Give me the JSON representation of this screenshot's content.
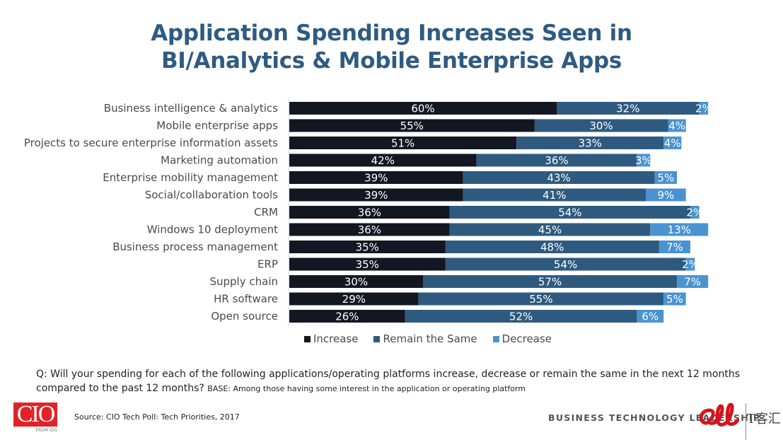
{
  "title_line1": "Application Spending Increases Seen in",
  "title_line2": "BI/Analytics & Mobile Enterprise Apps",
  "colors": {
    "increase": "#131722",
    "remain": "#2f5a7f",
    "decrease": "#4a93d1",
    "title": "#2e5b82",
    "cio_red": "#e32228"
  },
  "chart_data": {
    "type": "bar",
    "orientation": "horizontal",
    "stacked": true,
    "title": "Application Spending Increases Seen in BI/Analytics & Mobile Enterprise Apps",
    "xlabel": "",
    "ylabel": "",
    "xlim": [
      0,
      100
    ],
    "grid": false,
    "legend_position": "bottom",
    "categories": [
      "Business intelligence & analytics",
      "Mobile enterprise apps",
      "Projects to secure enterprise information assets",
      "Marketing automation",
      "Enterprise mobility management",
      "Social/collaboration tools",
      "CRM",
      "Windows 10 deployment",
      "Business process management",
      "ERP",
      "Supply chain",
      "HR software",
      "Open source"
    ],
    "series": [
      {
        "name": "Increase",
        "values": [
          60,
          55,
          51,
          42,
          39,
          39,
          36,
          36,
          35,
          35,
          30,
          29,
          26
        ]
      },
      {
        "name": "Remain the Same",
        "values": [
          32,
          30,
          33,
          36,
          43,
          41,
          54,
          45,
          48,
          54,
          57,
          55,
          52
        ]
      },
      {
        "name": "Decrease",
        "values": [
          2,
          4,
          4,
          3,
          5,
          9,
          2,
          13,
          7,
          2,
          7,
          5,
          6
        ]
      }
    ],
    "value_suffix": "%"
  },
  "legend": {
    "increase": "Increase",
    "remain": "Remain the Same",
    "decrease": "Decrease"
  },
  "footer": {
    "question": "Q: Will your spending for each of the following applications/operating platforms increase, decrease or remain the same in the next 12 months compared to the past 12 months?",
    "base": "BASE: Among those having some interest in the application or operating platform",
    "source": "Source: CIO Tech Poll: Tech Priorities, 2017",
    "cio_logo": "CIO",
    "from_idg": "FROM IDG",
    "tagline": "BUSINESS TECHNOLOGY LEADERSHIP",
    "watermark": "T客汇"
  }
}
